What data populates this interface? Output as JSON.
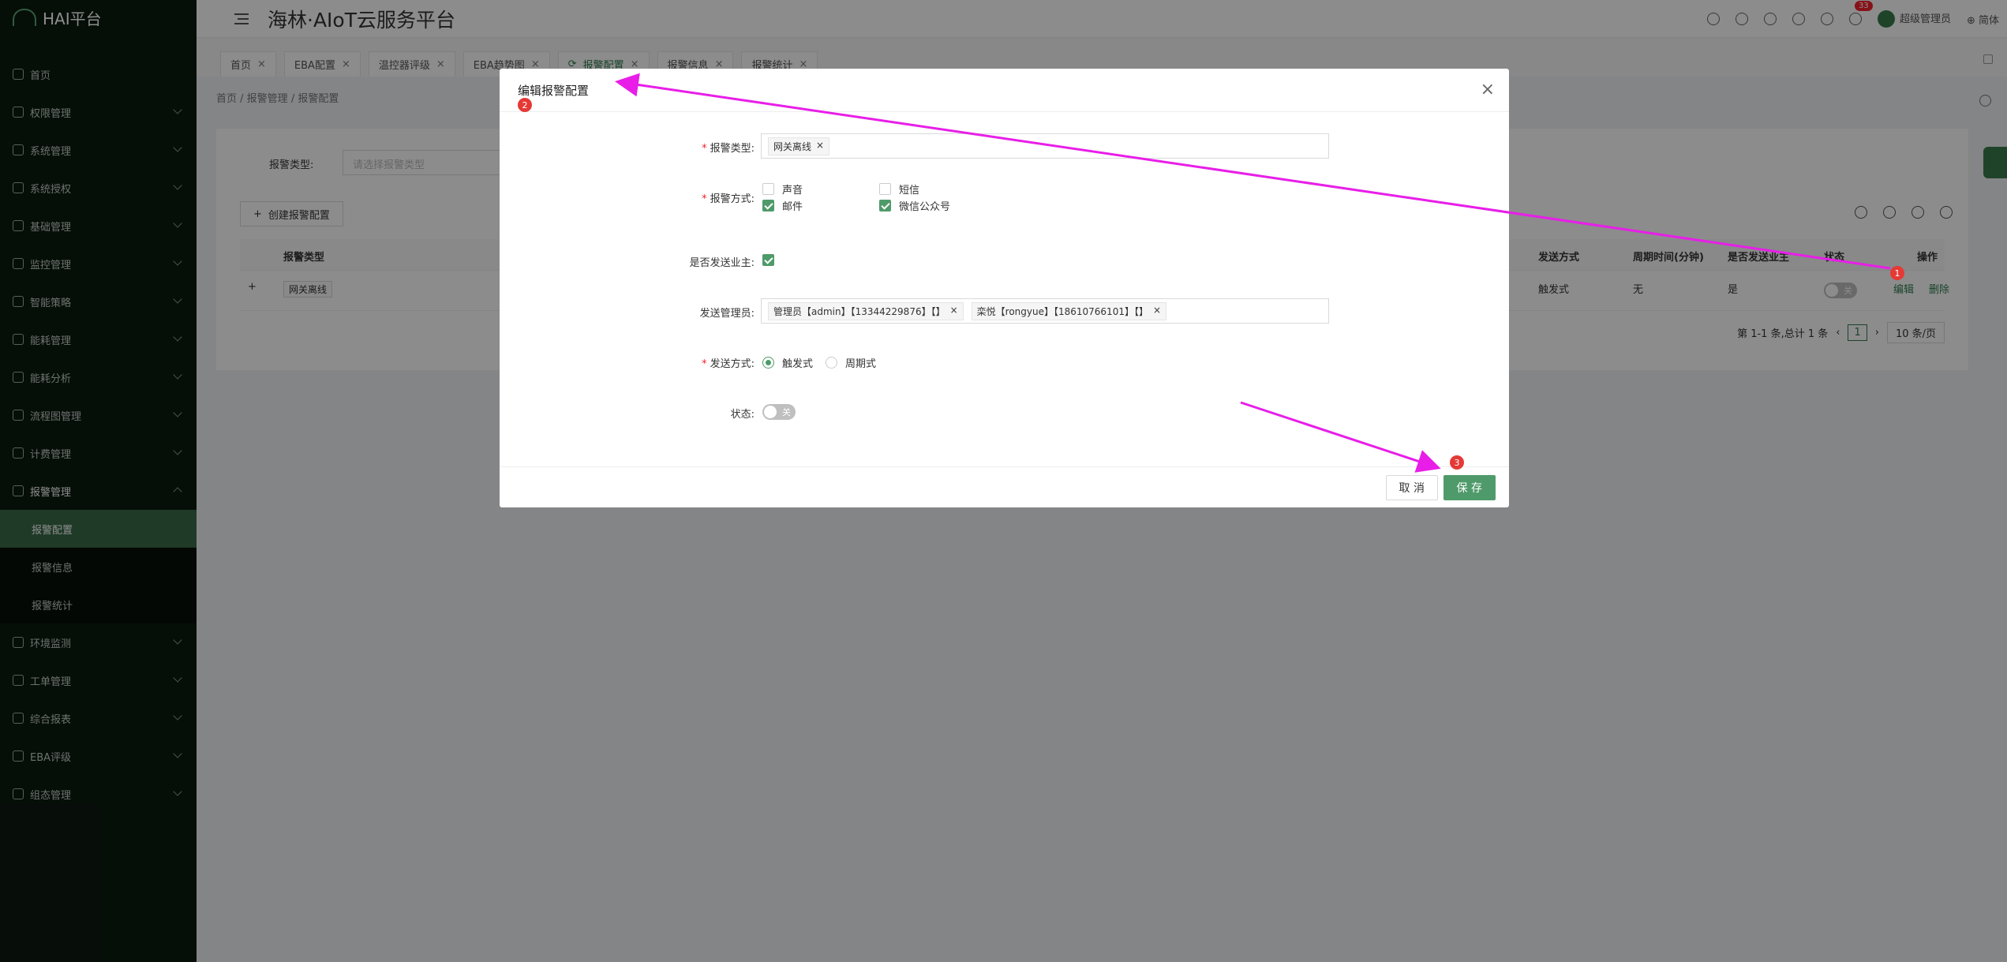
{
  "app": {
    "logo": "HAI平台",
    "title": "海林·AIoT云服务平台"
  },
  "sidebar": {
    "items": [
      {
        "label": "首页"
      },
      {
        "label": "权限管理"
      },
      {
        "label": "系统管理"
      },
      {
        "label": "系统授权"
      },
      {
        "label": "基础管理"
      },
      {
        "label": "监控管理"
      },
      {
        "label": "智能策略"
      },
      {
        "label": "能耗管理"
      },
      {
        "label": "能耗分析"
      },
      {
        "label": "流程图管理"
      },
      {
        "label": "计费管理"
      },
      {
        "label": "报警管理"
      }
    ],
    "sub": [
      {
        "label": "报警配置"
      },
      {
        "label": "报警信息"
      },
      {
        "label": "报警统计"
      }
    ],
    "items2": [
      {
        "label": "环境监测"
      },
      {
        "label": "工单管理"
      },
      {
        "label": "综合报表"
      },
      {
        "label": "EBA评级"
      },
      {
        "label": "组态管理"
      }
    ]
  },
  "header": {
    "notif_count": "33",
    "user": "超级管理员",
    "lang": "简体"
  },
  "tabs": [
    {
      "label": "首页"
    },
    {
      "label": "EBA配置"
    },
    {
      "label": "温控器评级"
    },
    {
      "label": "EBA趋势图"
    },
    {
      "label": "报警配置"
    },
    {
      "label": "报警信息"
    },
    {
      "label": "报警统计"
    }
  ],
  "breadcrumb": [
    "首页",
    "报警管理",
    "报警配置"
  ],
  "filter": {
    "label": "报警类型:",
    "placeholder": "请选择报警类型"
  },
  "create_btn": "创建报警配置",
  "table": {
    "headers": {
      "type": "报警类型",
      "method": "发送方式",
      "period": "周期时间(分钟)",
      "owner": "是否发送业主",
      "status": "状态",
      "ops": "操作"
    },
    "row": {
      "type": "网关离线",
      "method": "触发式",
      "period": "无",
      "owner": "是",
      "toggle": "关",
      "edit": "编辑",
      "del": "删除"
    }
  },
  "pager": {
    "total": "第 1-1 条,总计 1 条",
    "page": "1",
    "size": "10 条/页"
  },
  "modal": {
    "title": "编辑报警配置",
    "f_type": "报警类型:",
    "type_chip": "网关离线",
    "f_mode": "报警方式:",
    "opt_sound": "声音",
    "opt_sms": "短信",
    "opt_mail": "邮件",
    "opt_wechat": "微信公众号",
    "f_owner": "是否发送业主:",
    "f_admin": "发送管理员:",
    "admin1": "管理员【admin】【13344229876】【】",
    "admin2": "栾悦【rongyue】【18610766101】【】",
    "f_method": "发送方式:",
    "opt_trigger": "触发式",
    "opt_period": "周期式",
    "f_status": "状态:",
    "status_toggle": "关",
    "cancel": "取 消",
    "save": "保 存"
  },
  "markers": [
    "1",
    "2",
    "3"
  ],
  "annotation_color": "#e81ee8"
}
